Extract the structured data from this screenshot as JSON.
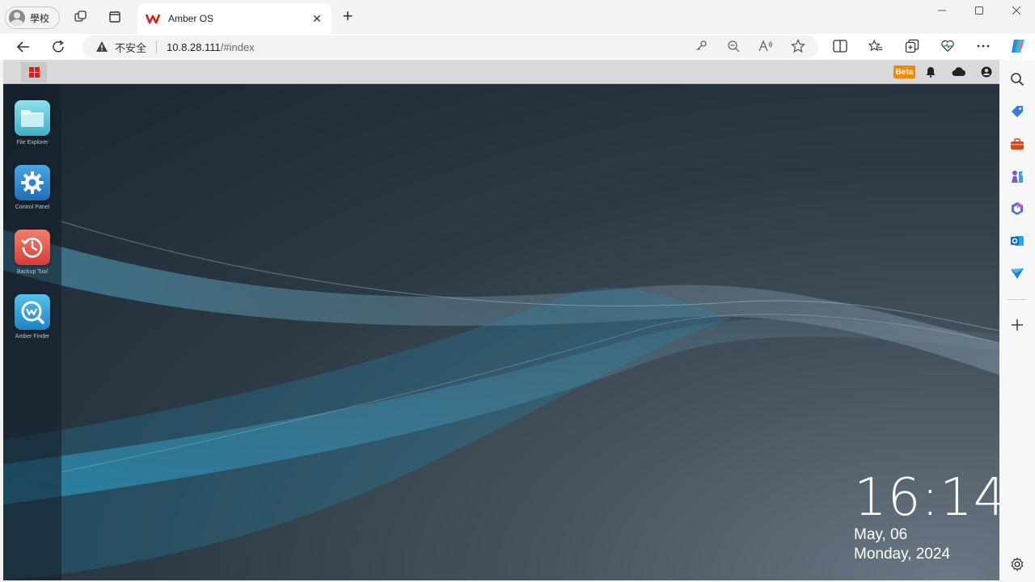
{
  "browser": {
    "profile_name": "學校",
    "tab": {
      "title": "Amber OS"
    },
    "address": {
      "security_label": "不安全",
      "url_host": "10.8.28.111",
      "url_path": "/#index"
    }
  },
  "os": {
    "topbar": {
      "beta_label": "Beta"
    },
    "apps": [
      {
        "label": "File Explorer"
      },
      {
        "label": "Control Panel"
      },
      {
        "label": "Backup Tool"
      },
      {
        "label": "Amber Finder"
      }
    ],
    "clock": {
      "time": "16:14",
      "date_line1": "May, 06",
      "date_line2": "Monday, 2024"
    }
  },
  "colors": {
    "beta_badge": "#f08a00",
    "start_icon": "#d0231f",
    "file_explorer": "#5ac4d6",
    "control_panel": "#2f86c9",
    "backup_tool": "#e25a4a",
    "amber_finder": "#2a9fd8"
  },
  "icons": [
    "person-icon",
    "collections-icon",
    "tab-actions-icon",
    "amber-logo-icon",
    "close-icon",
    "plus-icon",
    "minimize-icon",
    "maximize-icon",
    "back-arrow-icon",
    "refresh-icon",
    "warning-icon",
    "key-icon",
    "zoom-out-icon",
    "read-aloud-icon",
    "star-icon",
    "split-screen-icon",
    "favorites-icon",
    "collections-icon",
    "heartbeat-icon",
    "more-icon",
    "copilot-icon",
    "search-icon",
    "tag-icon",
    "toolbox-icon",
    "chess-icon",
    "copilot-m365-icon",
    "outlook-icon",
    "send-icon",
    "add-icon",
    "settings-icon",
    "bell-icon",
    "cloud-icon",
    "user-icon"
  ]
}
